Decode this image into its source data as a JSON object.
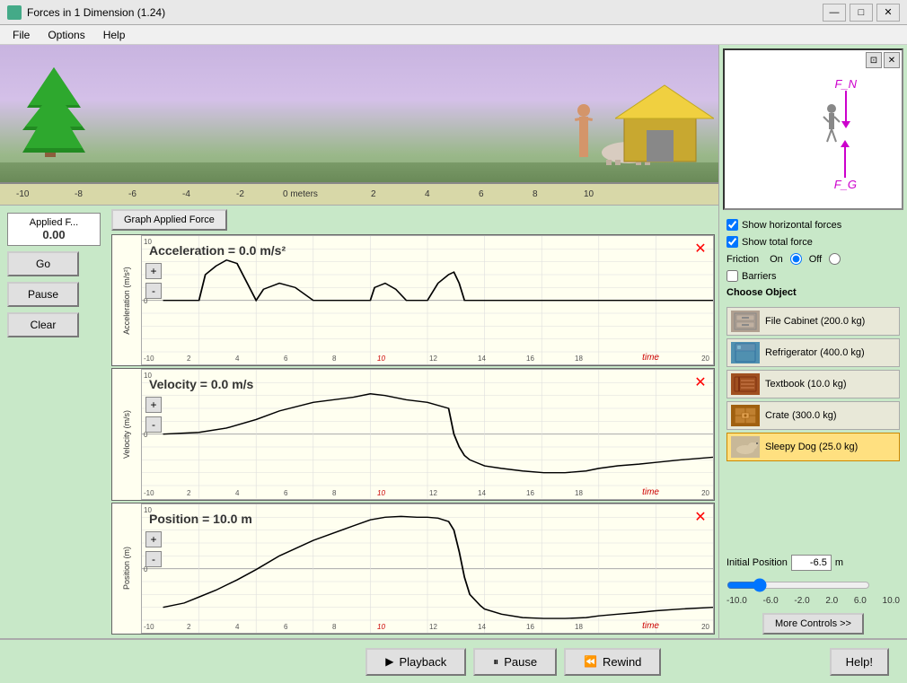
{
  "window": {
    "title": "Forces in 1 Dimension (1.24)",
    "icon": "physics-icon"
  },
  "titlebar": {
    "minimize": "—",
    "maximize": "□",
    "close": "✕"
  },
  "menubar": {
    "items": [
      "File",
      "Options",
      "Help"
    ]
  },
  "scene": {
    "ruler_labels": [
      "-10",
      "-8",
      "-6",
      "-4",
      "-2",
      "0 meters",
      "2",
      "4",
      "6",
      "8",
      "10"
    ]
  },
  "controls": {
    "applied_force_label": "Applied F...",
    "applied_force_value": "0.00",
    "go_label": "Go",
    "pause_label": "Pause",
    "clear_label": "Clear"
  },
  "graph_applied_btn": "Graph Applied Force",
  "graphs": [
    {
      "id": "acceleration",
      "y_label": "Acceleration (m/s²)",
      "value_label": "Acceleration = 0.0 m/s²",
      "x_label": "time",
      "y_min": -10,
      "y_max": 10,
      "x_max": 20
    },
    {
      "id": "velocity",
      "y_label": "Velocity (m/s)",
      "value_label": "Velocity = 0.0 m/s",
      "x_label": "time",
      "y_min": -10,
      "y_max": 10,
      "x_max": 20
    },
    {
      "id": "position",
      "y_label": "Position (m)",
      "value_label": "Position = 10.0 m",
      "x_label": "time",
      "y_min": -10,
      "y_max": 10,
      "x_max": 20
    }
  ],
  "force_diagram": {
    "fn_label": "F_N",
    "fg_label": "F_G"
  },
  "options": {
    "show_horizontal_forces": true,
    "show_total_force": true,
    "friction_on": true,
    "friction_off": false,
    "friction_label": "Friction",
    "friction_on_label": "On",
    "friction_off_label": "Off",
    "barriers_label": "Barriers",
    "barriers": false,
    "choose_object_label": "Choose Object"
  },
  "objects": [
    {
      "id": "file_cabinet",
      "label": "File Cabinet (200.0 kg)",
      "selected": false,
      "color": "#b0a090"
    },
    {
      "id": "refrigerator",
      "label": "Refrigerator (400.0 kg)",
      "selected": false,
      "color": "#5090b0"
    },
    {
      "id": "textbook",
      "label": "Textbook (10.0 kg)",
      "selected": false,
      "color": "#a05020"
    },
    {
      "id": "crate",
      "label": "Crate (300.0 kg)",
      "selected": false,
      "color": "#a06010"
    },
    {
      "id": "sleepy_dog",
      "label": "Sleepy Dog (25.0 kg)",
      "selected": true,
      "color": "#e0d080"
    }
  ],
  "initial_position": {
    "label": "Initial Position",
    "value": "-6.5",
    "unit": "m",
    "min": -10,
    "max": 10,
    "slider_labels": [
      "-10.0",
      "-6.0",
      "-2.0",
      "2.0",
      "6.0",
      "10.0"
    ]
  },
  "more_controls_btn": "More Controls >>",
  "help_btn": "Help!",
  "playback": {
    "playback_label": "Playback",
    "pause_label": "Pause",
    "rewind_label": "Rewind"
  }
}
